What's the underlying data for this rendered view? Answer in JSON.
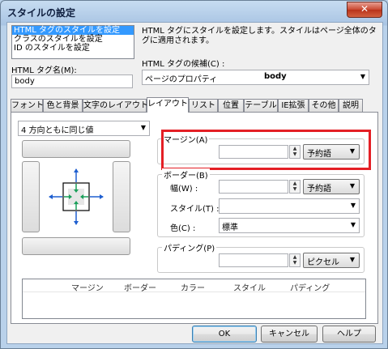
{
  "window": {
    "title": "スタイルの設定",
    "close_glyph": "✕"
  },
  "target_list": {
    "items": [
      {
        "label": "HTML タグのスタイルを設定",
        "selected": true
      },
      {
        "label": "クラスのスタイルを設定",
        "selected": false
      },
      {
        "label": "ID のスタイルを設定",
        "selected": false
      }
    ]
  },
  "description": "HTML タグにスタイルを設定します。スタイルはページ全体のタグに適用されます。",
  "tag_name": {
    "label": "HTML タグ名(M):",
    "value": "body"
  },
  "tag_candidates": {
    "label": "HTML タグの候補(C) :",
    "left_text": "ページのプロパティ",
    "value": "body"
  },
  "tabs": [
    {
      "label": "フォント",
      "active": false
    },
    {
      "label": "色と背景",
      "active": false
    },
    {
      "label": "文字のレイアウト",
      "active": false
    },
    {
      "label": "レイアウト",
      "active": true
    },
    {
      "label": "リスト",
      "active": false
    },
    {
      "label": "位置",
      "active": false
    },
    {
      "label": "テーブル",
      "active": false
    },
    {
      "label": "IE拡張",
      "active": false
    },
    {
      "label": "その他",
      "active": false
    },
    {
      "label": "説明",
      "active": false
    }
  ],
  "layout": {
    "direction_select": "4 方向ともに同じ値",
    "margin": {
      "legend": "マージン(A)",
      "value": "",
      "unit": "予約語"
    },
    "border": {
      "legend": "ボーダー(B)",
      "width_label": "幅(W) :",
      "width_value": "",
      "width_unit": "予約語",
      "style_label": "スタイル(T) :",
      "style_value": "",
      "color_label": "色(C) :",
      "color_value": "標準"
    },
    "padding": {
      "legend": "パディング(P)",
      "value": "",
      "unit": "ピクセル"
    },
    "table_headers": [
      "マージン",
      "ボーダー",
      "カラー",
      "スタイル",
      "パディング"
    ]
  },
  "buttons": {
    "ok": "OK",
    "cancel": "キャンセル",
    "help": "ヘルプ"
  },
  "colors": {
    "highlight": "#e41f25",
    "selection": "#3399ff",
    "arrow_blue": "#1f5fd0",
    "arrow_green": "#1aa05a"
  },
  "icons": {
    "spin_up": "▲",
    "spin_down": "▼",
    "dropdown": "▼"
  }
}
